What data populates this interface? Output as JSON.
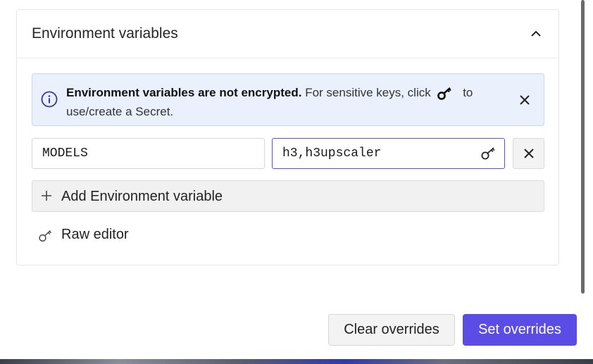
{
  "env_section": {
    "title": "Environment variables",
    "toggle_icon": "chevron-up-icon"
  },
  "banner": {
    "bold_text": "Environment variables are not encrypted.",
    "text_before_icon": "For sensitive keys, click",
    "text_after_icon": "to use/create a Secret.",
    "icon": "info-icon",
    "close_icon": "close-icon",
    "accent_color": "#2f3aa8"
  },
  "variables": [
    {
      "name": "MODELS",
      "value": "h3,h3upscaler"
    }
  ],
  "add_button_label": "Add Environment variable",
  "raw_editor_label": "Raw editor",
  "footer": {
    "clear_label": "Clear overrides",
    "set_label": "Set overrides",
    "primary_color": "#5b4ce6"
  }
}
